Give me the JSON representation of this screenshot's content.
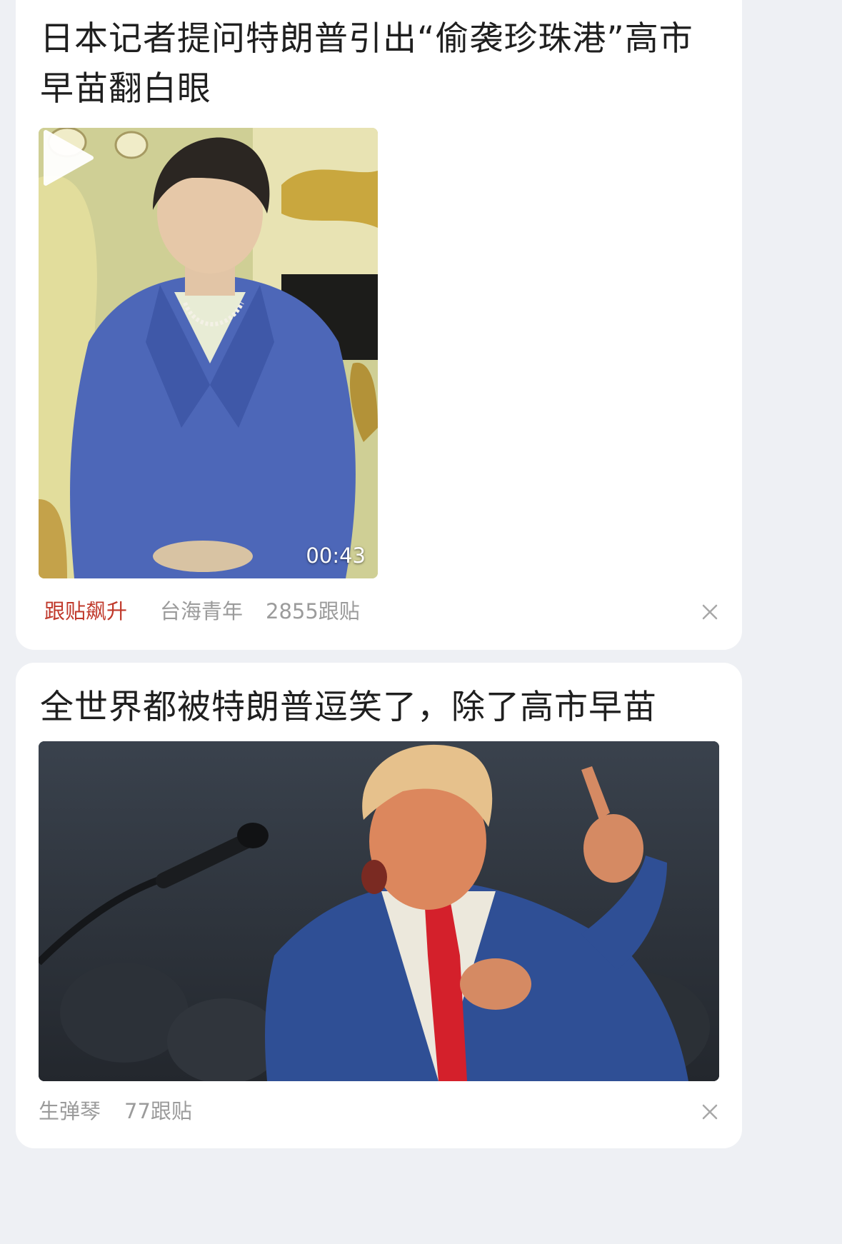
{
  "feed": {
    "items": [
      {
        "headline": "日本记者提问特朗普引出“偷袭珍珠港”高市早苗翻白眼",
        "media_type": "video",
        "duration": "00:43",
        "tag": "跟贴飙升",
        "source": "台海青年",
        "comments": "2855跟贴"
      },
      {
        "headline": "全世界都被特朗普逗笑了，除了高市早苗",
        "media_type": "image",
        "source": "生弹琴",
        "comments": "77跟贴"
      }
    ]
  },
  "icons": {
    "play": "play-icon",
    "close": "close-icon"
  },
  "colors": {
    "background": "#eef0f4",
    "card": "#ffffff",
    "headline": "#1f1f1f",
    "meta": "#9b9b9b",
    "tag": "#c0392b"
  }
}
